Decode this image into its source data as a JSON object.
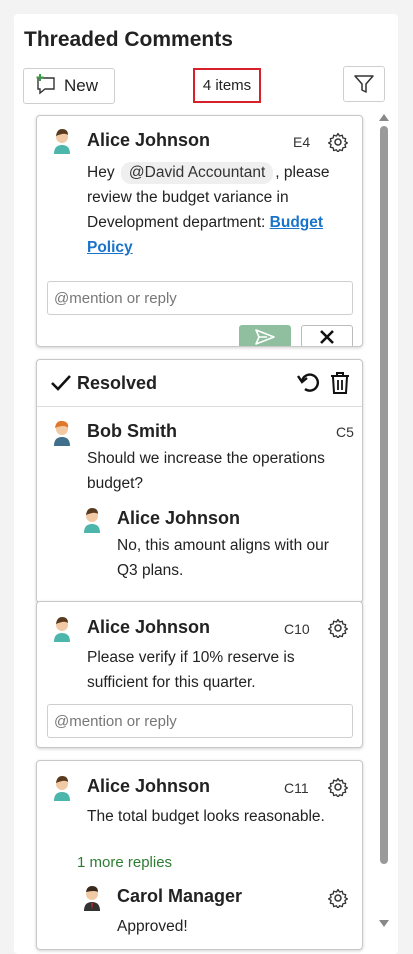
{
  "panel": {
    "title": "Threaded Comments",
    "new_label": "New",
    "count_label": "4 items"
  },
  "colors": {
    "accent_green": "#8fbf9f",
    "link": "#1a73c9",
    "highlight_border": "#d6202a",
    "more_replies": "#2e7d32"
  },
  "threads": [
    {
      "author": "Alice Johnson",
      "cell": "E4",
      "text_before": "Hey",
      "mention": "@David Accountant",
      "text_mid": ", please review the budget variance in Development department:",
      "link": "Budget Policy",
      "reply_placeholder": "@mention or reply"
    },
    {
      "status": "Resolved",
      "author": "Bob Smith",
      "cell": "C5",
      "text": "Should we increase the operations budget?",
      "reply": {
        "author": "Alice Johnson",
        "text": "No, this amount aligns with our Q3 plans."
      }
    },
    {
      "author": "Alice Johnson",
      "cell": "C10",
      "text": "Please verify if 10% reserve is sufficient for this quarter.",
      "reply_placeholder": "@mention or reply"
    },
    {
      "author": "Alice Johnson",
      "cell": "C11",
      "text": "The total budget looks reasonable.",
      "more_replies": "1 more replies",
      "reply": {
        "author": "Carol Manager",
        "text": "Approved!"
      }
    }
  ]
}
